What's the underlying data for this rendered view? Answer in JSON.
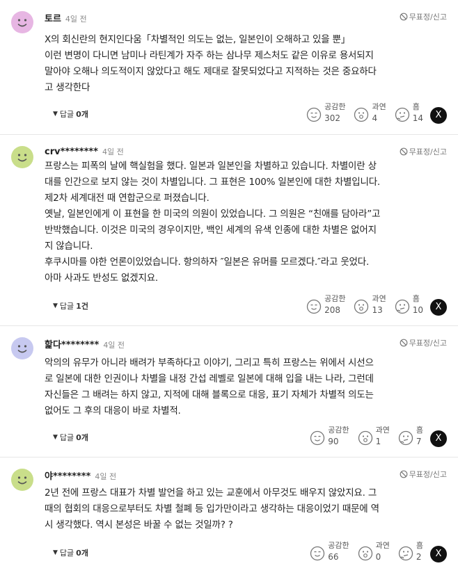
{
  "report_label": "무표정/신고",
  "reaction_labels": {
    "empathy": "공감한",
    "excessive": "과연",
    "hmm": "흠"
  },
  "share_icon": "X",
  "icons": {
    "avatar": "smiley-face-icon",
    "report": "prohibited-icon",
    "empathy": "calm-face-icon",
    "excessive": "surprised-face-icon",
    "hmm": "thinking-face-icon",
    "share": "x-logo-icon"
  },
  "comments": [
    {
      "avatar_color": "#e7b6e3",
      "author": "토르",
      "time": "4일 전",
      "lines": [
        "X의 회신란의 현지인다움「차별적인 의도는 없는, 일본인이 오해하고 있을 뿐」",
        " 이런 변명이 다니면 남미나 라틴계가 자주 하는 삼나무 제스처도 같은 이유로 용서되지",
        "말아야 오해나 의도적이지 않았다고 해도 제대로 잘못되었다고 지적하는 것은 중요하다",
        "고 생각한다"
      ],
      "reply_label": "답글",
      "reply_count": "0개",
      "empathy": "302",
      "excessive": "4",
      "hmm": "14"
    },
    {
      "avatar_color": "#c9de8a",
      "author": "crv********",
      "time": "4일 전",
      "lines": [
        "프랑스는 피폭의 날에 핵실험을 했다. 일본과 일본인을 차별하고 있습니다. 차별이란 상",
        "대를 인간으로 보지 않는 것이 차별입니다. 그 표현은 100% 일본인에 대한 차별입니다.",
        "제2차 세계대전 때 연합군으로 퍼졌습니다.",
        " 옛날, 일본인에게 이 표현을 한 미국의 의원이 있었습니다. 그 의원은 “친애를 담아라”고",
        "반박했습니다. 이것은 미국의 경우이지만, 백인 세계의 유색 인종에 대한 차별은 없어지",
        "지 않습니다.",
        " 후쿠시마를 야한 언론이있었습니다. 항의하자 ″일본은 유머를 모르겠다.″라고 웃었다.",
        " 아마 사과도 반성도 없겠지요."
      ],
      "reply_label": "답글",
      "reply_count": "1건",
      "empathy": "208",
      "excessive": "13",
      "hmm": "10"
    },
    {
      "avatar_color": "#c7c9f0",
      "author": "핥다********",
      "time": "4일 전",
      "lines": [
        "악의의 유무가 아니라 배려가 부족하다고 이야기, 그리고 특히 프랑스는 위에서 시선으",
        "로 일본에 대한 인권이나 차별을 내정 간섭 레벨로 일본에 대해 입을 내는 나라, 그런데",
        "자신들은 그 배려는 하지 않고, 지적에 대해 블록으로 대응, 표기 자체가 차별적 의도는",
        "없어도 그 후의 대응이 바로 차별적."
      ],
      "reply_label": "답글",
      "reply_count": "0개",
      "empathy": "90",
      "excessive": "1",
      "hmm": "7"
    },
    {
      "avatar_color": "#c9de8a",
      "author": "야********",
      "time": "4일 전",
      "lines": [
        "2년 전에 프랑스 대표가 차별 발언을 하고 있는 교훈에서 아무것도 배우지 않았지요. 그",
        "때의 협회의 대응으로부터도 차별 철폐 등 입가만이라고 생각하는 대응이었기 때문에 역",
        "시 생각했다. 역시 본성은 바꿀 수 없는 것일까? ?"
      ],
      "reply_label": "답글",
      "reply_count": "0개",
      "empathy": "66",
      "excessive": "0",
      "hmm": "2"
    }
  ]
}
